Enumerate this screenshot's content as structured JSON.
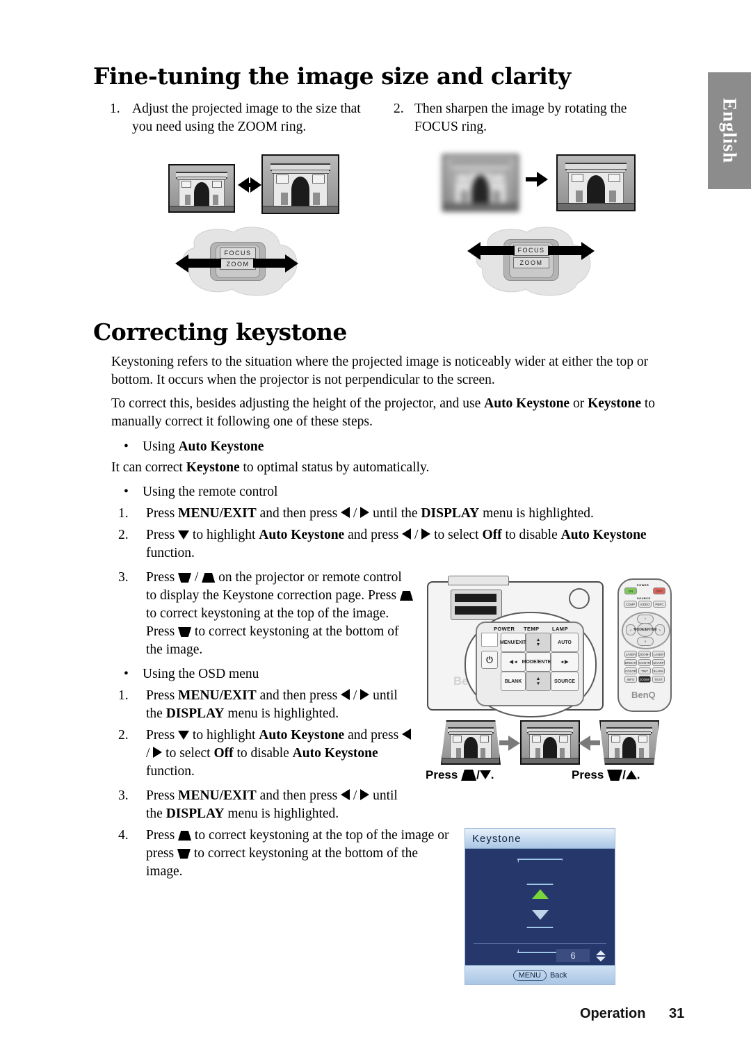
{
  "page": {
    "language_tab": "English",
    "footer_section": "Operation",
    "footer_page_number": "31"
  },
  "section_finetune": {
    "heading": "Fine-tuning the image size and clarity",
    "steps": [
      {
        "number": "1.",
        "text": "Adjust the projected image to the size that you need using the ZOOM ring."
      },
      {
        "number": "2.",
        "text": "Then sharpen the image by rotating the FOCUS ring."
      }
    ],
    "ring_labels": {
      "focus": "FOCUS",
      "zoom": "ZOOM"
    }
  },
  "section_keystone": {
    "heading": "Correcting keystone",
    "intro_1": "Keystoning refers to the situation where the projected image is noticeably wider at either the top or bottom. It occurs when the projector is not perpendicular to the screen.",
    "intro_2_a": "To correct this, besides adjusting the height of the projector, and use ",
    "intro_2_b": "Auto Keystone",
    "intro_2_c": " or ",
    "intro_2_d": "Keystone",
    "intro_2_e": " to manually correct it following one of these steps.",
    "bullet_auto": "Using ",
    "bullet_auto_bold": "Auto Keystone",
    "auto_desc_a": "It can correct ",
    "auto_desc_bold": "Keystone",
    "auto_desc_b": " to optimal status by automatically.",
    "bullet_remote": "Using the remote control",
    "remote_steps": [
      {
        "number": "1.",
        "parts": [
          "Press ",
          "MENU/EXIT",
          " and then press ",
          "◀ / ▶",
          " until the ",
          "DISPLAY",
          " menu is highlighted."
        ]
      },
      {
        "number": "2.",
        "parts": [
          "Press ",
          "▼",
          " to highlight ",
          "Auto Keystone",
          " and press ",
          "◀ / ▶",
          " to select ",
          "Off",
          " to disable ",
          "Auto Keystone",
          " function."
        ]
      },
      {
        "number": "3.",
        "parts": [
          "Press ",
          "trapezoid-down / trapezoid-up",
          " on the projector or remote control to display the Keystone correction page. Press ",
          "trapezoid-up",
          " to correct keystoning at the top of the image. Press ",
          "trapezoid-down",
          " to correct keystoning at the bottom of the image."
        ]
      }
    ],
    "bullet_osd": "Using the OSD menu",
    "osd_steps": [
      {
        "number": "1.",
        "parts": [
          "Press ",
          "MENU/EXIT",
          " and then press ",
          "◀ / ▶",
          " until the ",
          "DISPLAY",
          " menu is highlighted."
        ]
      },
      {
        "number": "2.",
        "parts": [
          "Press ",
          "▼",
          " to highlight ",
          "Auto Keystone",
          " and press ",
          "◀ / ▶",
          " to select ",
          "Off",
          " to disable ",
          "Auto Keystone",
          " function."
        ]
      },
      {
        "number": "3.",
        "parts": [
          "Press ",
          "MENU/EXIT",
          " and then press ",
          "◀ / ▶",
          " until the ",
          "DISPLAY",
          " menu is highlighted."
        ]
      },
      {
        "number": "4.",
        "parts": [
          "Press ",
          "trapezoid-up",
          " to correct keystoning at the top of the image or press ",
          "trapezoid-down",
          " to correct keystoning at the bottom of the image."
        ]
      }
    ],
    "captions": {
      "left_press": "Press",
      "left_suffix": "/",
      "left_end": ".",
      "right_press": "Press",
      "right_suffix": "/",
      "right_end": "."
    }
  },
  "projector_panel": {
    "indicators": [
      "POWER",
      "TEMP",
      "LAMP"
    ],
    "buttons": [
      "MENU/EXIT",
      "AUTO",
      "MODE/ENTER",
      "BLANK",
      "SOURCE"
    ],
    "power_icon": "power-icon"
  },
  "remote_control": {
    "power_on": "ON",
    "power_off": "OFF",
    "source_label": "SOURCE",
    "source_buttons": [
      "COMP",
      "VIDEO",
      "PBPC"
    ],
    "center_button": "MODE/ENTER",
    "brand": "BenQ",
    "keypad": [
      [
        "LASER",
        "ZOOM+",
        "LASER"
      ],
      [
        "BRIGHT",
        "CONTR",
        "SHARP"
      ],
      [
        "COLOR",
        "TINT",
        "BLANK"
      ],
      [
        "INFO",
        "ZOOM-",
        "TEST"
      ]
    ]
  },
  "osd_dialog": {
    "title": "Keystone",
    "value": "6",
    "menu_key_label": "MENU",
    "back_label": "Back",
    "accent_green": "#79d63a",
    "panel_bg": "#26376b",
    "title_bar_from": "#e8f1fb",
    "title_bar_to": "#a9c6e4"
  }
}
